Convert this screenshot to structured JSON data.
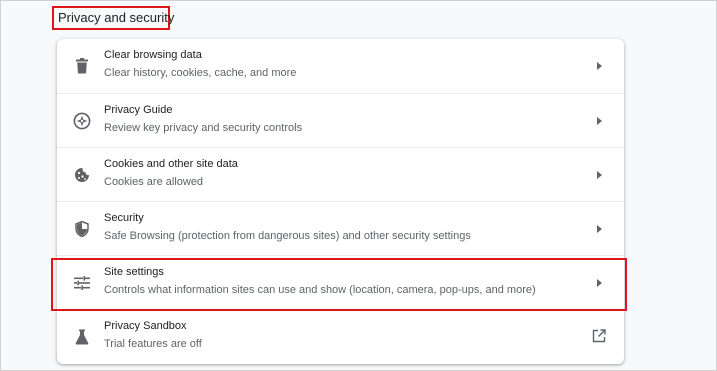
{
  "section": {
    "title": "Privacy and security"
  },
  "items": [
    {
      "label": "Clear browsing data",
      "description": "Clear history, cookies, cache, and more",
      "icon": "trash-icon",
      "action": "chevron-right-icon"
    },
    {
      "label": "Privacy Guide",
      "description": "Review key privacy and security controls",
      "icon": "privacy-guide-icon",
      "action": "chevron-right-icon"
    },
    {
      "label": "Cookies and other site data",
      "description": "Cookies are allowed",
      "icon": "cookie-icon",
      "action": "chevron-right-icon"
    },
    {
      "label": "Security",
      "description": "Safe Browsing (protection from dangerous sites) and other security settings",
      "icon": "shield-icon",
      "action": "chevron-right-icon"
    },
    {
      "label": "Site settings",
      "description": "Controls what information sites can use and show (location, camera, pop-ups, and more)",
      "icon": "tune-icon",
      "action": "chevron-right-icon"
    },
    {
      "label": "Privacy Sandbox",
      "description": "Trial features are off",
      "icon": "flask-icon",
      "action": "open-in-new-icon"
    }
  ],
  "colors": {
    "highlight": "#e0151c",
    "icon": "#5f6368",
    "text": "#202124",
    "subtext": "#5f6368"
  }
}
